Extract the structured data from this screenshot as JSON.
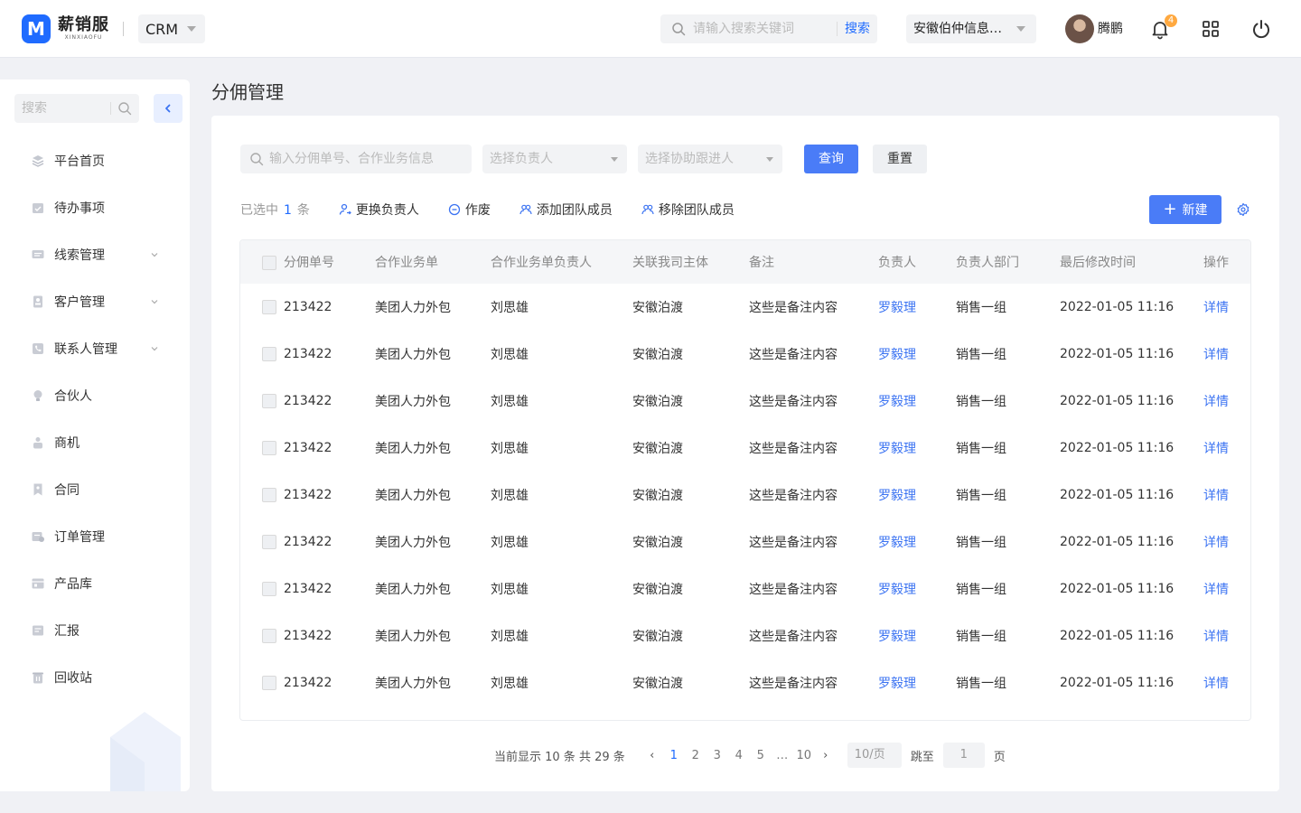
{
  "app": {
    "logo_letter": "M",
    "brand_name": "薪销服",
    "brand_sub": "XINXIAOFU",
    "module": "CRM"
  },
  "header": {
    "search_placeholder": "请输入搜索关键词",
    "search_button": "搜索",
    "company": "安徽伯仲信息科技有限公司",
    "user_name": "腾鹏",
    "notification_count": "4"
  },
  "sidebar": {
    "search_placeholder": "搜索",
    "items": [
      {
        "label": "平台首页",
        "icon": "layers-icon",
        "has_children": false
      },
      {
        "label": "待办事项",
        "icon": "calendar-check-icon",
        "has_children": false
      },
      {
        "label": "线索管理",
        "icon": "message-icon",
        "has_children": true
      },
      {
        "label": "客户管理",
        "icon": "customer-icon",
        "has_children": true
      },
      {
        "label": "联系人管理",
        "icon": "contact-phone-icon",
        "has_children": true
      },
      {
        "label": "合伙人",
        "icon": "lightbulb-icon",
        "has_children": false
      },
      {
        "label": "商机",
        "icon": "opportunity-icon",
        "has_children": false
      },
      {
        "label": "合同",
        "icon": "contract-bookmark-icon",
        "has_children": false
      },
      {
        "label": "订单管理",
        "icon": "order-icon",
        "has_children": false
      },
      {
        "label": "产品库",
        "icon": "product-library-icon",
        "has_children": false
      },
      {
        "label": "汇报",
        "icon": "report-icon",
        "has_children": false
      },
      {
        "label": "回收站",
        "icon": "recycle-bin-icon",
        "has_children": false
      }
    ]
  },
  "page": {
    "title": "分佣管理"
  },
  "filters": {
    "keyword_placeholder": "输入分佣单号、合作业务信息",
    "owner_placeholder": "选择负责人",
    "assistant_placeholder": "选择协助跟进人",
    "query_button": "查询",
    "reset_button": "重置"
  },
  "toolbar": {
    "selected_prefix": "已选中",
    "selected_count": "1",
    "selected_suffix": "条",
    "change_owner": "更换负责人",
    "void": "作废",
    "add_member": "添加团队成员",
    "remove_member": "移除团队成员",
    "new_button": "新建"
  },
  "table": {
    "columns": [
      "分佣单号",
      "合作业务单",
      "合作业务单负责人",
      "关联我司主体",
      "备注",
      "负责人",
      "负责人部门",
      "最后修改时间",
      "操作"
    ],
    "rows": [
      {
        "id": "213422",
        "business": "美团人力外包",
        "business_owner": "刘思雄",
        "entity": "安徽泊渡",
        "remark": "这些是备注内容",
        "owner": "罗毅理",
        "dept": "销售一组",
        "modified": "2022-01-05 11:16",
        "action": "详情"
      },
      {
        "id": "213422",
        "business": "美团人力外包",
        "business_owner": "刘思雄",
        "entity": "安徽泊渡",
        "remark": "这些是备注内容",
        "owner": "罗毅理",
        "dept": "销售一组",
        "modified": "2022-01-05 11:16",
        "action": "详情"
      },
      {
        "id": "213422",
        "business": "美团人力外包",
        "business_owner": "刘思雄",
        "entity": "安徽泊渡",
        "remark": "这些是备注内容",
        "owner": "罗毅理",
        "dept": "销售一组",
        "modified": "2022-01-05 11:16",
        "action": "详情"
      },
      {
        "id": "213422",
        "business": "美团人力外包",
        "business_owner": "刘思雄",
        "entity": "安徽泊渡",
        "remark": "这些是备注内容",
        "owner": "罗毅理",
        "dept": "销售一组",
        "modified": "2022-01-05 11:16",
        "action": "详情"
      },
      {
        "id": "213422",
        "business": "美团人力外包",
        "business_owner": "刘思雄",
        "entity": "安徽泊渡",
        "remark": "这些是备注内容",
        "owner": "罗毅理",
        "dept": "销售一组",
        "modified": "2022-01-05 11:16",
        "action": "详情"
      },
      {
        "id": "213422",
        "business": "美团人力外包",
        "business_owner": "刘思雄",
        "entity": "安徽泊渡",
        "remark": "这些是备注内容",
        "owner": "罗毅理",
        "dept": "销售一组",
        "modified": "2022-01-05 11:16",
        "action": "详情"
      },
      {
        "id": "213422",
        "business": "美团人力外包",
        "business_owner": "刘思雄",
        "entity": "安徽泊渡",
        "remark": "这些是备注内容",
        "owner": "罗毅理",
        "dept": "销售一组",
        "modified": "2022-01-05 11:16",
        "action": "详情"
      },
      {
        "id": "213422",
        "business": "美团人力外包",
        "business_owner": "刘思雄",
        "entity": "安徽泊渡",
        "remark": "这些是备注内容",
        "owner": "罗毅理",
        "dept": "销售一组",
        "modified": "2022-01-05 11:16",
        "action": "详情"
      },
      {
        "id": "213422",
        "business": "美团人力外包",
        "business_owner": "刘思雄",
        "entity": "安徽泊渡",
        "remark": "这些是备注内容",
        "owner": "罗毅理",
        "dept": "销售一组",
        "modified": "2022-01-05 11:16",
        "action": "详情"
      }
    ]
  },
  "pagination": {
    "summary": "当前显示 10 条 共 29 条",
    "pages": [
      "1",
      "2",
      "3",
      "4",
      "5",
      "…",
      "10"
    ],
    "current": "1",
    "page_size": "10/页",
    "jump_label": "跳至",
    "jump_value": "1",
    "jump_unit": "页"
  },
  "colors": {
    "primary": "#4a7cf7",
    "link": "#3b73f2",
    "badge": "#ffa940",
    "brand": "#1f6bff"
  }
}
